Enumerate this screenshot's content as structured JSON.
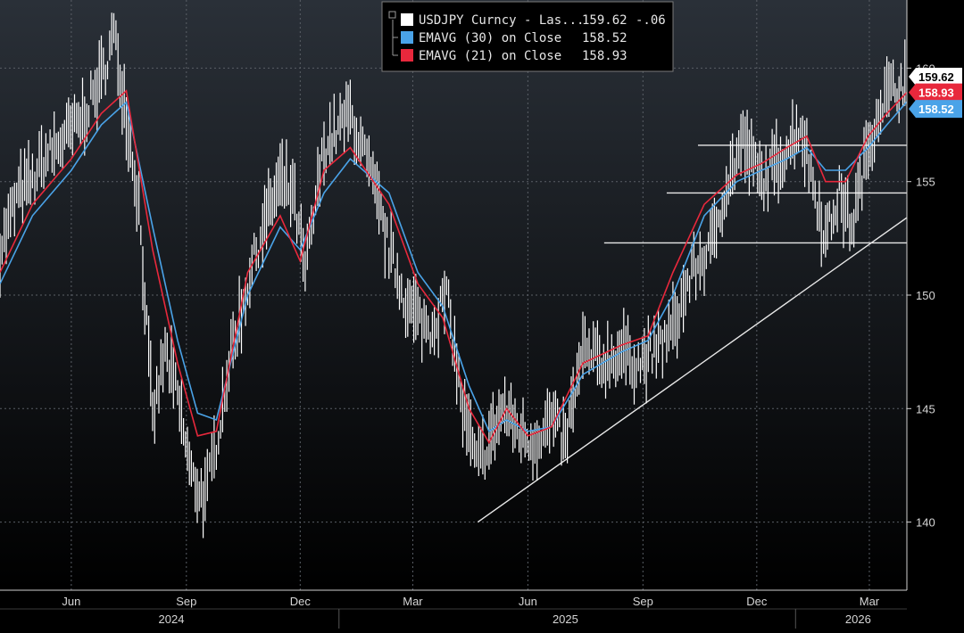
{
  "chart_data": {
    "type": "line",
    "ylim": [
      137,
      163
    ],
    "x_range": [
      "2024-04-05",
      "2026-03-31"
    ],
    "grid": true,
    "legend_placement": "top-center",
    "colors": {
      "background_top": "#2a3038",
      "background_bottom": "#000000",
      "price": "#ffffff",
      "ema30": "#4aa3e8",
      "ema21": "#e8283c",
      "grid": "#5a5f66",
      "lines": "#e8e8e8"
    },
    "y_ticks": [
      140,
      145,
      150,
      155,
      160
    ],
    "x_ticks": [
      {
        "date": "2024-06-01",
        "label": "Jun"
      },
      {
        "date": "2024-09-01",
        "label": "Sep"
      },
      {
        "date": "2024-12-01",
        "label": "Dec"
      },
      {
        "date": "2025-03-01",
        "label": "Mar"
      },
      {
        "date": "2025-06-01",
        "label": "Jun"
      },
      {
        "date": "2025-09-01",
        "label": "Sep"
      },
      {
        "date": "2025-12-01",
        "label": "Dec"
      },
      {
        "date": "2026-03-01",
        "label": "Mar"
      }
    ],
    "years": [
      {
        "label": "2024",
        "center": "2024-08-20"
      },
      {
        "label": "2025",
        "center": "2025-07-01"
      },
      {
        "label": "2026",
        "center": "2026-02-20"
      }
    ],
    "year_dividers": [
      "2025-01-01",
      "2026-01-01"
    ],
    "legend": [
      {
        "label": "USDJPY Curncy - Las...",
        "value": "159.62",
        "change": "-.06",
        "color": "#ffffff"
      },
      {
        "label": "EMAVG (30)  on Close",
        "value": "158.52",
        "change": "",
        "color": "#4aa3e8"
      },
      {
        "label": "EMAVG (21)  on Close",
        "value": "158.93",
        "change": "",
        "color": "#e8283c"
      }
    ],
    "price_tags": [
      {
        "value": "159.62",
        "y": 159.62,
        "bg": "#ffffff",
        "fg": "#000000"
      },
      {
        "value": "158.93",
        "y": 158.93,
        "bg": "#e8283c",
        "fg": "#ffffff"
      },
      {
        "value": "158.52",
        "y": 158.52,
        "bg": "#4aa3e8",
        "fg": "#ffffff"
      }
    ],
    "series": [
      {
        "name": "USDJPY Curncy",
        "x": [
          "2024-04-05",
          "2024-04-20",
          "2024-05-01",
          "2024-05-10",
          "2024-05-25",
          "2024-06-10",
          "2024-06-25",
          "2024-07-05",
          "2024-07-15",
          "2024-07-25",
          "2024-08-05",
          "2024-08-15",
          "2024-08-25",
          "2024-09-05",
          "2024-09-16",
          "2024-09-25",
          "2024-10-05",
          "2024-10-20",
          "2024-11-01",
          "2024-11-15",
          "2024-11-25",
          "2024-12-05",
          "2024-12-20",
          "2025-01-10",
          "2025-01-25",
          "2025-02-10",
          "2025-02-25",
          "2025-03-05",
          "2025-03-15",
          "2025-03-28",
          "2025-04-10",
          "2025-04-21",
          "2025-05-01",
          "2025-05-12",
          "2025-05-25",
          "2025-06-05",
          "2025-06-20",
          "2025-07-01",
          "2025-07-15",
          "2025-07-30",
          "2025-08-15",
          "2025-08-30",
          "2025-09-10",
          "2025-09-25",
          "2025-10-10",
          "2025-10-25",
          "2025-11-05",
          "2025-11-20",
          "2025-12-05",
          "2025-12-20",
          "2026-01-05",
          "2026-01-15",
          "2026-01-25",
          "2026-02-05",
          "2026-02-15",
          "2026-02-28",
          "2026-03-10",
          "2026-03-20",
          "2026-03-31"
        ],
        "y": [
          152.0,
          154.5,
          155.0,
          156.0,
          156.8,
          157.8,
          159.5,
          161.5,
          158.0,
          154.0,
          144.5,
          147.5,
          145.5,
          142.0,
          141.0,
          143.5,
          147.0,
          150.5,
          153.0,
          155.0,
          154.5,
          151.0,
          156.5,
          158.0,
          155.5,
          152.0,
          149.5,
          149.0,
          148.5,
          150.0,
          145.0,
          142.5,
          143.5,
          145.0,
          144.0,
          143.5,
          144.5,
          143.5,
          147.5,
          147.0,
          147.5,
          147.0,
          147.5,
          148.5,
          151.0,
          152.0,
          154.5,
          156.8,
          155.0,
          156.0,
          157.5,
          155.0,
          152.5,
          154.5,
          153.0,
          156.5,
          158.5,
          159.0,
          159.62
        ]
      },
      {
        "name": "EMAVG (30)",
        "x": [
          "2024-04-05",
          "2024-05-01",
          "2024-06-01",
          "2024-06-25",
          "2024-07-15",
          "2024-08-05",
          "2024-08-25",
          "2024-09-10",
          "2024-09-25",
          "2024-10-20",
          "2024-11-15",
          "2024-12-01",
          "2024-12-20",
          "2025-01-10",
          "2025-02-10",
          "2025-03-05",
          "2025-03-25",
          "2025-04-15",
          "2025-05-01",
          "2025-05-15",
          "2025-06-01",
          "2025-06-20",
          "2025-07-15",
          "2025-08-15",
          "2025-09-05",
          "2025-09-25",
          "2025-10-20",
          "2025-11-15",
          "2025-12-05",
          "2025-12-25",
          "2026-01-10",
          "2026-01-25",
          "2026-02-10",
          "2026-02-28",
          "2026-03-15",
          "2026-03-31"
        ],
        "y": [
          150.5,
          153.5,
          155.5,
          157.5,
          158.5,
          153.0,
          148.0,
          144.8,
          144.5,
          150.0,
          153.0,
          152.0,
          154.5,
          156.0,
          154.5,
          151.0,
          149.5,
          146.0,
          144.0,
          144.5,
          144.0,
          144.2,
          146.5,
          147.5,
          148.0,
          150.0,
          153.5,
          155.0,
          155.5,
          156.0,
          156.5,
          155.5,
          155.5,
          156.5,
          157.5,
          158.52
        ]
      },
      {
        "name": "EMAVG (21)",
        "x": [
          "2024-04-05",
          "2024-05-01",
          "2024-06-01",
          "2024-06-25",
          "2024-07-15",
          "2024-08-05",
          "2024-08-25",
          "2024-09-10",
          "2024-09-25",
          "2024-10-20",
          "2024-11-15",
          "2024-12-01",
          "2024-12-20",
          "2025-01-10",
          "2025-02-10",
          "2025-03-05",
          "2025-03-25",
          "2025-04-15",
          "2025-05-01",
          "2025-05-15",
          "2025-06-01",
          "2025-06-20",
          "2025-07-15",
          "2025-08-15",
          "2025-09-05",
          "2025-09-25",
          "2025-10-20",
          "2025-11-15",
          "2025-12-05",
          "2025-12-25",
          "2026-01-10",
          "2026-01-25",
          "2026-02-10",
          "2026-02-28",
          "2026-03-15",
          "2026-03-31"
        ],
        "y": [
          151.0,
          154.0,
          156.0,
          158.0,
          159.0,
          152.0,
          147.0,
          143.8,
          144.0,
          151.0,
          153.5,
          151.5,
          155.5,
          156.5,
          154.0,
          150.5,
          149.0,
          145.0,
          143.5,
          145.0,
          143.8,
          144.2,
          147.0,
          147.8,
          148.2,
          151.0,
          154.0,
          155.3,
          155.8,
          156.5,
          157.0,
          155.0,
          155.0,
          157.0,
          158.0,
          158.93
        ]
      }
    ],
    "annotations": [
      {
        "type": "trendline",
        "from": [
          "2025-04-22",
          140.0
        ],
        "to": [
          "2026-04-15",
          154.0
        ]
      },
      {
        "type": "hline",
        "y": 156.6,
        "from": "2025-10-15",
        "to": "2026-04-10"
      },
      {
        "type": "hline",
        "y": 154.5,
        "from": "2025-09-20",
        "to": "2026-04-10"
      },
      {
        "type": "hline",
        "y": 152.3,
        "from": "2025-08-01",
        "to": "2026-04-10"
      }
    ]
  }
}
